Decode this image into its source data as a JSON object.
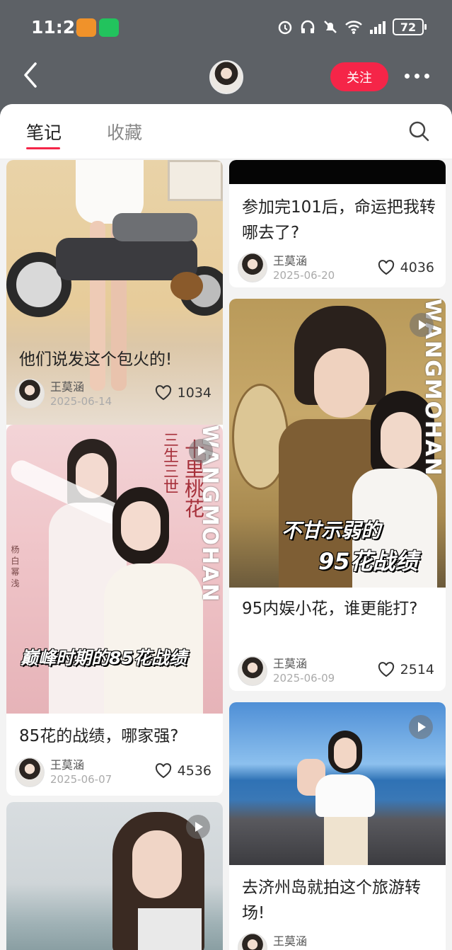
{
  "status_bar": {
    "time": "11:23",
    "battery": "72"
  },
  "header": {
    "follow_label": "关注"
  },
  "tabs": [
    {
      "label": "笔记",
      "active": true
    },
    {
      "label": "收藏",
      "active": false
    }
  ],
  "accent_color": "#f52548",
  "cards": [
    {
      "title": "他们说发这个包火的!",
      "author": "王莫涵",
      "date": "2025-06-14",
      "likes": "1034"
    },
    {
      "title": "参加完101后，命运把我转哪去了?",
      "author": "王莫涵",
      "date": "2025-06-20",
      "likes": "4036"
    },
    {
      "title": "95内娱小花，谁更能打?",
      "author": "王莫涵",
      "date": "2025-06-09",
      "likes": "2514",
      "overlay_line1": "不甘示弱的",
      "overlay_line2": "95花战绩",
      "watermark": "WANGMOHAN"
    },
    {
      "title": "85花的战绩，哪家强?",
      "author": "王莫涵",
      "date": "2025-06-07",
      "likes": "4536",
      "overlay": "巅峰时期的85花战绩",
      "poster_title": "十里桃花",
      "poster_subtitle": "三生三世",
      "poster_cast": "杨 白 幂 浅",
      "watermark": "WANGMOHAN"
    },
    {
      "title": "去济州岛就拍这个旅游转场!",
      "author": "王莫涵"
    },
    {}
  ]
}
